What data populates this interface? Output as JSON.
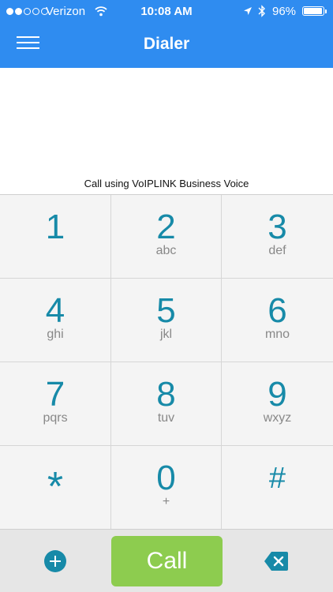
{
  "status_bar": {
    "carrier": "Verizon",
    "time": "10:08 AM",
    "battery_percent": "96%",
    "battery_level": 0.96,
    "signal_bars_filled": 2,
    "signal_bars_total": 5
  },
  "header": {
    "title": "Dialer",
    "color": "#2f8cf0"
  },
  "display": {
    "call_using_text": "Call using VoIPLINK Business Voice"
  },
  "keypad": {
    "keys": [
      {
        "digit": "1",
        "letters": ""
      },
      {
        "digit": "2",
        "letters": "abc"
      },
      {
        "digit": "3",
        "letters": "def"
      },
      {
        "digit": "4",
        "letters": "ghi"
      },
      {
        "digit": "5",
        "letters": "jkl"
      },
      {
        "digit": "6",
        "letters": "mno"
      },
      {
        "digit": "7",
        "letters": "pqrs"
      },
      {
        "digit": "8",
        "letters": "tuv"
      },
      {
        "digit": "9",
        "letters": "wxyz"
      },
      {
        "digit": "*",
        "letters": ""
      },
      {
        "digit": "0",
        "letters": "+"
      },
      {
        "digit": "#",
        "letters": ""
      }
    ],
    "key_color": "#178aa8"
  },
  "bottom_bar": {
    "add_icon": "plus-circle-icon",
    "call_label": "Call",
    "call_color": "#8dcc4f",
    "backspace_icon": "backspace-icon"
  }
}
